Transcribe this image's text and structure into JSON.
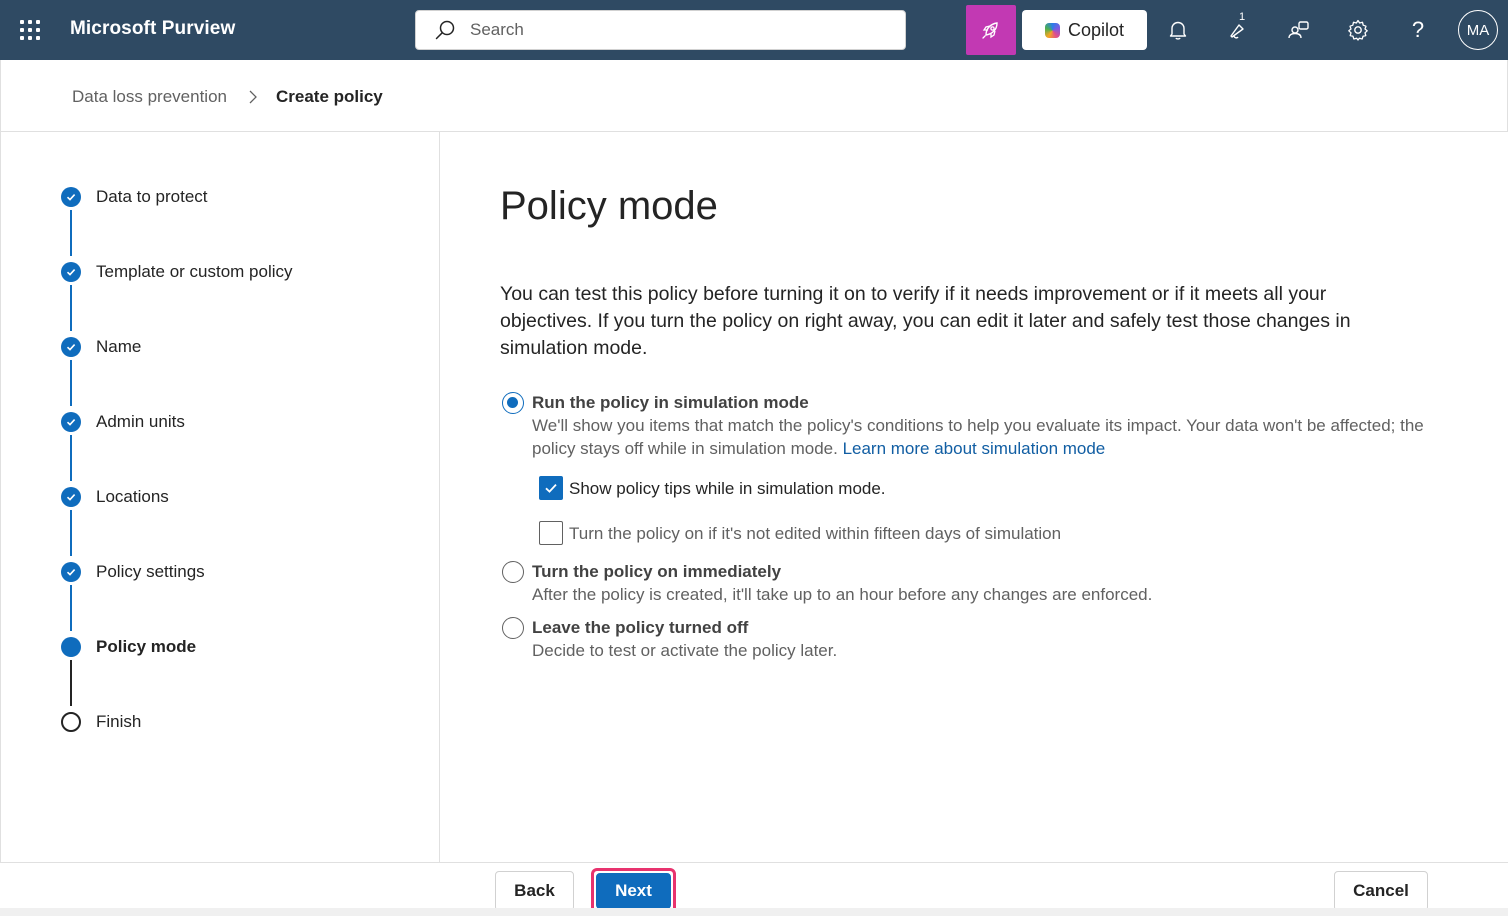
{
  "header": {
    "app_title": "Microsoft Purview",
    "search_placeholder": "Search",
    "copilot_label": "Copilot",
    "notification_count": "1",
    "help_label": "?",
    "avatar_initials": "MA",
    "colors": {
      "bar": "#2f4a63",
      "rocket": "#c239b3"
    }
  },
  "breadcrumb": {
    "parent": "Data loss prevention",
    "current": "Create policy"
  },
  "stepper": {
    "steps": [
      {
        "label": "Data to protect",
        "state": "done"
      },
      {
        "label": "Template or custom policy",
        "state": "done"
      },
      {
        "label": "Name",
        "state": "done"
      },
      {
        "label": "Admin units",
        "state": "done"
      },
      {
        "label": "Locations",
        "state": "done"
      },
      {
        "label": "Policy settings",
        "state": "done"
      },
      {
        "label": "Policy mode",
        "state": "current"
      },
      {
        "label": "Finish",
        "state": "todo"
      }
    ]
  },
  "main": {
    "title": "Policy mode",
    "intro": "You can test this policy before turning it on to verify if it needs improvement or if it meets all your objectives. If you turn the policy on right away, you can edit it later and safely test those changes in simulation mode.",
    "options": [
      {
        "title": "Run the policy in simulation mode",
        "desc": "We'll show you items that match the policy's conditions to help you evaluate its impact. Your data won't be affected; the policy stays off while in simulation mode.",
        "link": "Learn more about simulation mode",
        "selected": true
      },
      {
        "title": "Turn the policy on immediately",
        "desc": "After the policy is created, it'll take up to an hour before any changes are enforced.",
        "selected": false
      },
      {
        "title": "Leave the policy turned off",
        "desc": "Decide to test or activate the policy later.",
        "selected": false
      }
    ],
    "sub_options": [
      {
        "label": "Show policy tips while in simulation mode.",
        "checked": true
      },
      {
        "label": "Turn the policy on if it's not edited within fifteen days of simulation",
        "checked": false
      }
    ]
  },
  "footer": {
    "back_label": "Back",
    "next_label": "Next",
    "cancel_label": "Cancel"
  },
  "accent_color": "#0f6cbd"
}
